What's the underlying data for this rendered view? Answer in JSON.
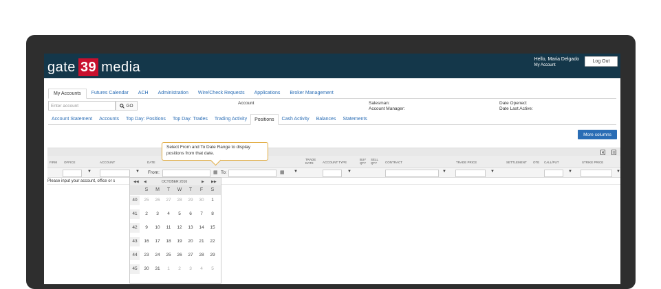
{
  "brand": {
    "part1": "gate",
    "part2": "39",
    "part3": "media"
  },
  "user": {
    "greeting": "Hello, Maria Delgado",
    "account_link": "My Account",
    "logout": "Log Out"
  },
  "main_tabs": [
    "My Accounts",
    "Futures Calendar",
    "ACH",
    "Administration",
    "Wire/Check Requests",
    "Applications",
    "Broker Management"
  ],
  "account": {
    "placeholder": "Enter account",
    "go_label": "GO",
    "account_label": "Account",
    "salesman_label": "Salesman:",
    "manager_label": "Account Manager:",
    "opened_label": "Date Opened:",
    "last_active_label": "Date Last Active:"
  },
  "sub_tabs": [
    "Account Statement",
    "Accounts",
    "Top Day: Positions",
    "Top Day: Trades",
    "Trading Activity",
    "Positions",
    "Cash Activity",
    "Balances",
    "Statements"
  ],
  "active_sub_tab": "Positions",
  "more_columns": "More columns",
  "tooltip": {
    "line1": "Select From and To Date Range to display",
    "line2": "positions from that date."
  },
  "columns": {
    "firm": "FIRM",
    "office": "OFFICE",
    "account": "ACCOUNT",
    "date": "DATE",
    "trade_date_1": "TRADE",
    "trade_date_2": "DATE",
    "account_type": "ACCOUNT TYPE",
    "buy_1": "BUY",
    "buy_2": "QTY",
    "sell_1": "SELL",
    "sell_2": "QTY",
    "contract": "CONTRACT",
    "trade_price": "TRADE PRICE",
    "settlement": "SETTLEMENT",
    "ote": "OTE",
    "callput": "CALL/PUT",
    "strike": "STRIKE PRICE"
  },
  "filter": {
    "from_label": "From:",
    "to_label": "To:"
  },
  "message": "Please input your account, office or s",
  "calendar": {
    "month": "OCTOBER 2016",
    "nav": {
      "first": "◀◀",
      "prev": "◀",
      "next": "▶",
      "last": "▶▶"
    },
    "dow": [
      "S",
      "M",
      "T",
      "W",
      "T",
      "F",
      "S"
    ],
    "weeks": [
      {
        "wk": "40",
        "days": [
          "25",
          "26",
          "27",
          "28",
          "29",
          "30",
          "1"
        ]
      },
      {
        "wk": "41",
        "days": [
          "2",
          "3",
          "4",
          "5",
          "6",
          "7",
          "8"
        ]
      },
      {
        "wk": "42",
        "days": [
          "9",
          "10",
          "11",
          "12",
          "13",
          "14",
          "15"
        ]
      },
      {
        "wk": "43",
        "days": [
          "16",
          "17",
          "18",
          "19",
          "20",
          "21",
          "22"
        ]
      },
      {
        "wk": "44",
        "days": [
          "23",
          "24",
          "25",
          "26",
          "27",
          "28",
          "29"
        ]
      },
      {
        "wk": "45",
        "days": [
          "30",
          "31",
          "1",
          "2",
          "3",
          "4",
          "5"
        ]
      }
    ]
  }
}
